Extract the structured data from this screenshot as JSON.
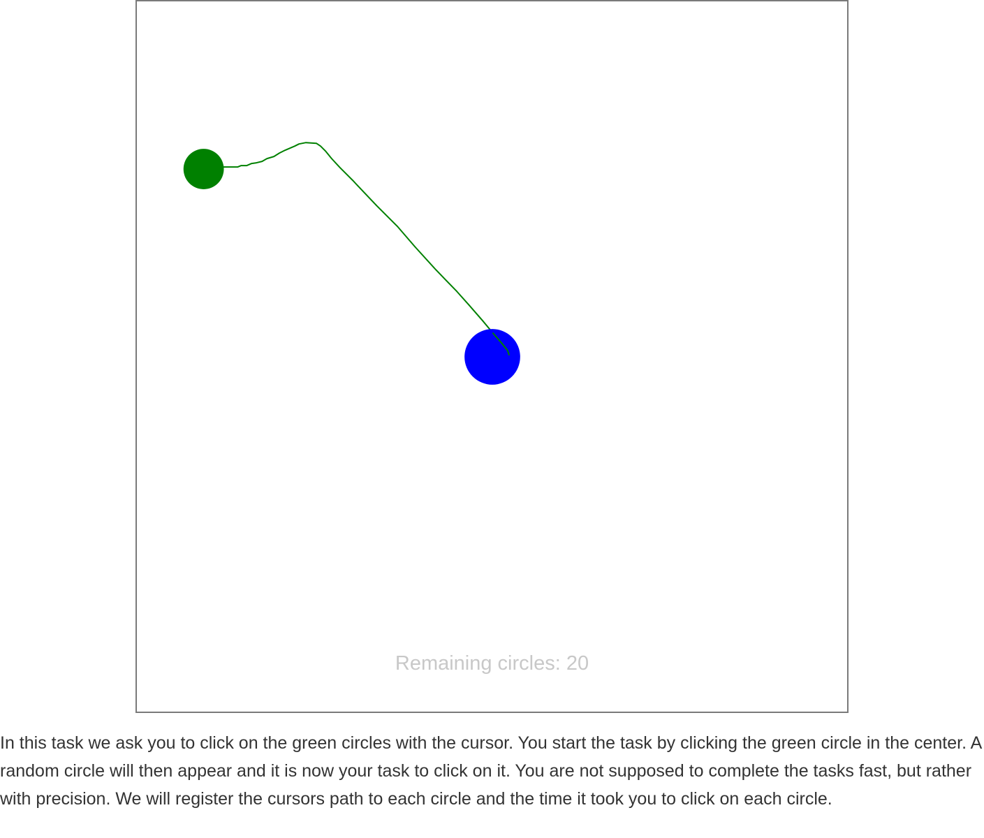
{
  "task": {
    "remaining_label": "Remaining circles: 20",
    "instructions": "In this task we ask you to click on the green circles with the cursor. You start the task by clicking the green circle in the center. A random circle will then appear and it is now your task to click on it. You are not supposed to complete the tasks fast, but rather with precision. We will register the cursors path to each circle and the time it took you to click on each circle."
  },
  "colors": {
    "target_circle": "#008000",
    "cursor_circle": "#0000ff",
    "cursor_path": "#008000",
    "remaining_text": "#c8c8c8",
    "canvas_border": "#7a7a7a"
  }
}
